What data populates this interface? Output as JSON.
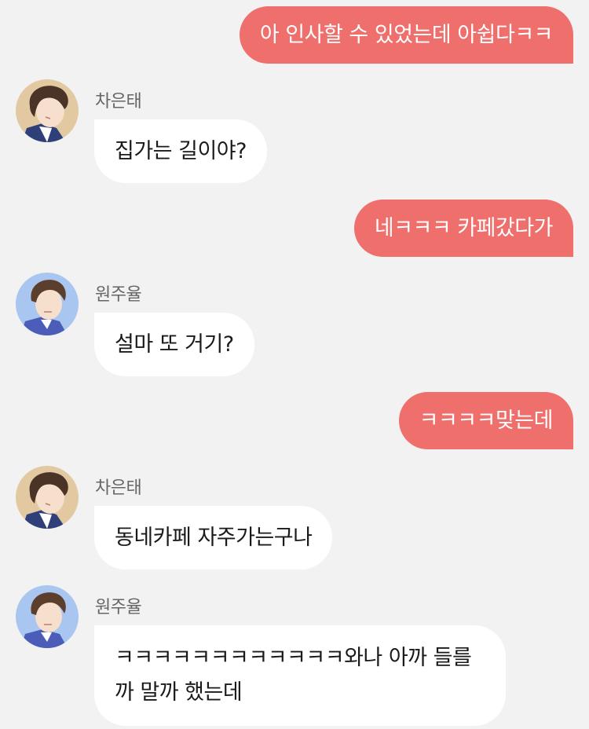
{
  "chat": {
    "messages": [
      {
        "from": "me",
        "text": "아 인사할 수 있었는데 아쉽다ㅋㅋ"
      },
      {
        "from": "other",
        "sender": "차은태",
        "avatar": "brown-hair-avatar",
        "text": "집가는 길이야?"
      },
      {
        "from": "me",
        "text": "네ㅋㅋㅋ 카페갔다가"
      },
      {
        "from": "other",
        "sender": "원주율",
        "avatar": "curly-hair-avatar",
        "text": "설마 또 거기?"
      },
      {
        "from": "me",
        "text": "ㅋㅋㅋㅋ맞는데"
      },
      {
        "from": "other",
        "sender": "차은태",
        "avatar": "brown-hair-avatar",
        "text": "동네카페 자주가는구나"
      },
      {
        "from": "other",
        "sender": "원주율",
        "avatar": "curly-hair-avatar",
        "text": "ㅋㅋㅋㅋㅋㅋㅋㅋㅋㅋㅋㅋ와나 아까 들를까 말까 했는데"
      }
    ]
  },
  "colors": {
    "background": "#f2f2f2",
    "my_bubble": "#ee6f6c",
    "other_bubble": "#ffffff",
    "sender_name": "#666666"
  }
}
